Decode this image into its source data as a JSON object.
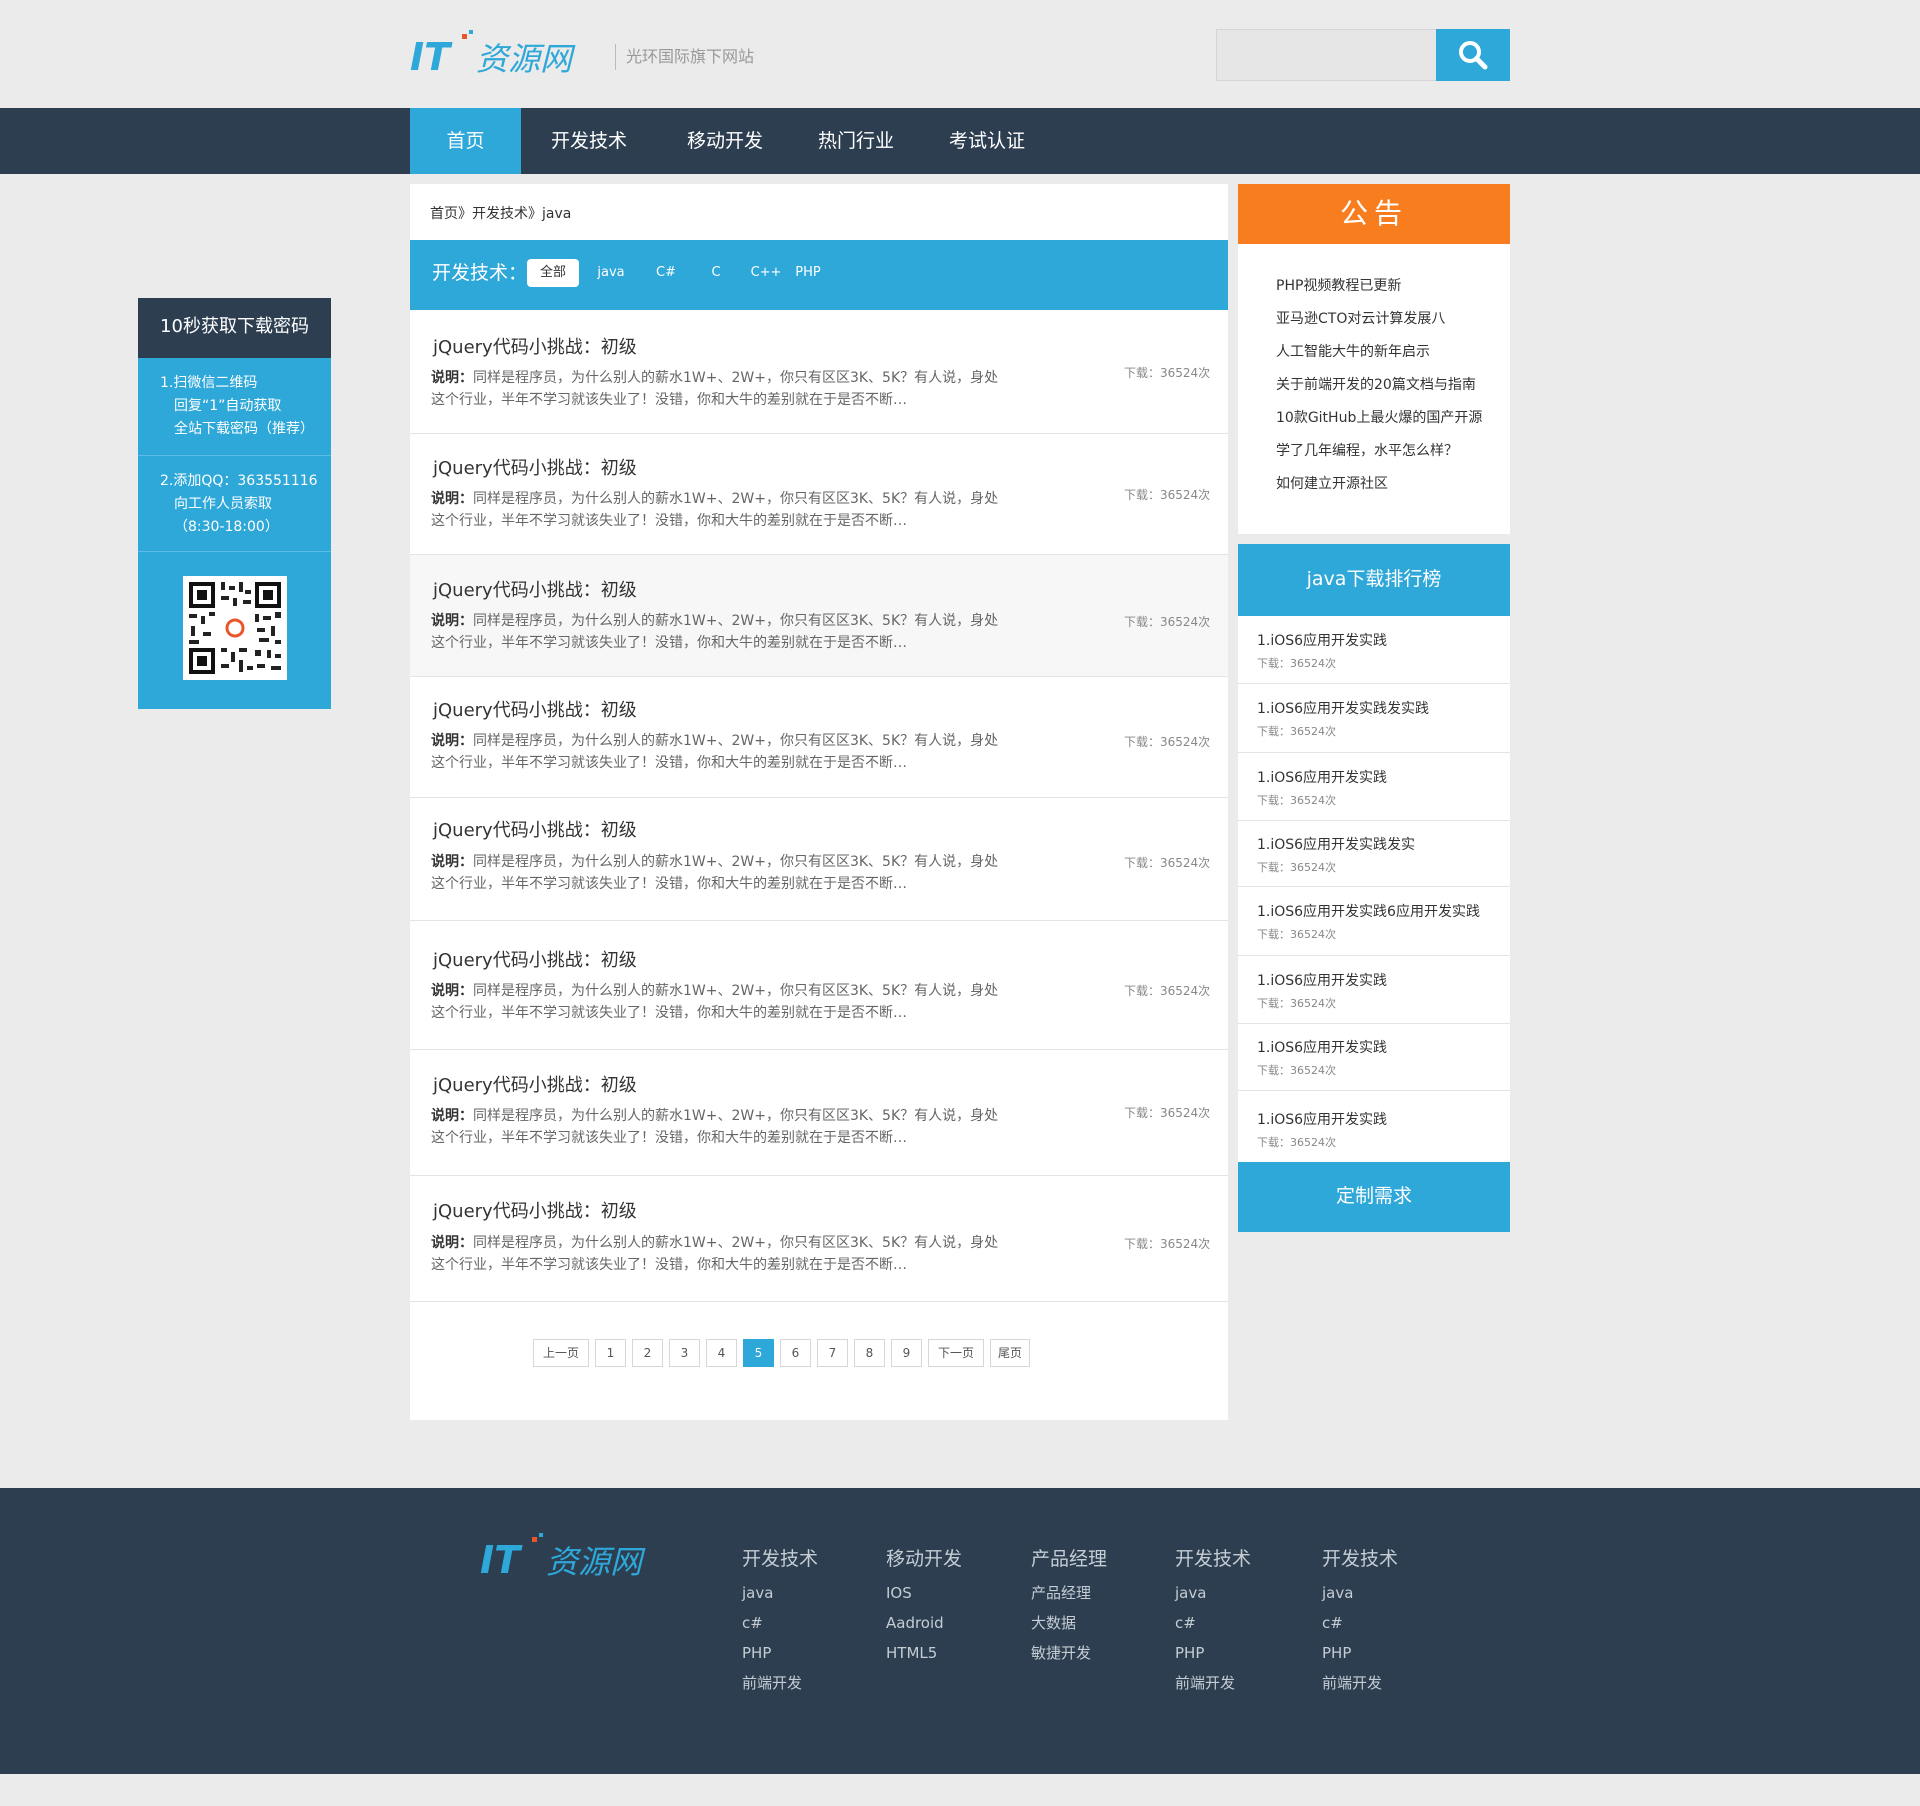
{
  "header": {
    "logo_text": "IT资源网",
    "slogan": "光环国际旗下网站",
    "search_placeholder": ""
  },
  "nav": {
    "items": [
      "首页",
      "开发技术",
      "移动开发",
      "热门行业",
      "考试认证"
    ],
    "active": 0
  },
  "float_panel": {
    "title": "10秒获取下载密码",
    "step1": [
      "1.扫微信二维码",
      "回复“1”自动获取",
      "全站下载密码（推荐）"
    ],
    "step2": [
      "2.添加QQ：363551116",
      "向工作人员索取",
      "（8:30-18:00）"
    ]
  },
  "breadcrumb": "首页》开发技术》java",
  "category": {
    "label": "开发技术：",
    "tabs": [
      "全部",
      "java",
      "C#",
      "C",
      "C++",
      "PHP"
    ],
    "selected": 0
  },
  "items": [
    {
      "title": "jQuery代码小挑战：初级",
      "desc_label": "说明：",
      "desc": "同样是程序员，为什么别人的薪水1W+、2W+，你只有区区3K、5K？有人说，身处这个行业，半年不学习就该失业了！没错，你和大牛的差别就在于是否不断…",
      "downloads": "下载：36524次"
    },
    {
      "title": "jQuery代码小挑战：初级",
      "desc_label": "说明：",
      "desc": "同样是程序员，为什么别人的薪水1W+、2W+，你只有区区3K、5K？有人说，身处这个行业，半年不学习就该失业了！没错，你和大牛的差别就在于是否不断…",
      "downloads": "下载：36524次"
    },
    {
      "title": "jQuery代码小挑战：初级",
      "desc_label": "说明：",
      "desc": "同样是程序员，为什么别人的薪水1W+、2W+，你只有区区3K、5K？有人说，身处这个行业，半年不学习就该失业了！没错，你和大牛的差别就在于是否不断…",
      "downloads": "下载：36524次"
    },
    {
      "title": "jQuery代码小挑战：初级",
      "desc_label": "说明：",
      "desc": "同样是程序员，为什么别人的薪水1W+、2W+，你只有区区3K、5K？有人说，身处这个行业，半年不学习就该失业了！没错，你和大牛的差别就在于是否不断…",
      "downloads": "下载：36524次"
    },
    {
      "title": "jQuery代码小挑战：初级",
      "desc_label": "说明：",
      "desc": "同样是程序员，为什么别人的薪水1W+、2W+，你只有区区3K、5K？有人说，身处这个行业，半年不学习就该失业了！没错，你和大牛的差别就在于是否不断…",
      "downloads": "下载：36524次"
    },
    {
      "title": "jQuery代码小挑战：初级",
      "desc_label": "说明：",
      "desc": "同样是程序员，为什么别人的薪水1W+、2W+，你只有区区3K、5K？有人说，身处这个行业，半年不学习就该失业了！没错，你和大牛的差别就在于是否不断…",
      "downloads": "下载：36524次"
    },
    {
      "title": "jQuery代码小挑战：初级",
      "desc_label": "说明：",
      "desc": "同样是程序员，为什么别人的薪水1W+、2W+，你只有区区3K、5K？有人说，身处这个行业，半年不学习就该失业了！没错，你和大牛的差别就在于是否不断…",
      "downloads": "下载：36524次"
    },
    {
      "title": "jQuery代码小挑战：初级",
      "desc_label": "说明：",
      "desc": "同样是程序员，为什么别人的薪水1W+、2W+，你只有区区3K、5K？有人说，身处这个行业，半年不学习就该失业了！没错，你和大牛的差别就在于是否不断…",
      "downloads": "下载：36524次"
    }
  ],
  "pagination": {
    "prev": "上一页",
    "pages": [
      "1",
      "2",
      "3",
      "4",
      "5",
      "6",
      "7",
      "8",
      "9"
    ],
    "current": "5",
    "next": "下一页",
    "last": "尾页"
  },
  "notice": {
    "title": "公告",
    "items": [
      "PHP视频教程已更新",
      "亚马逊CTO对云计算发展八",
      "人工智能大牛的新年启示",
      "关于前端开发的20篇文档与指南",
      "10款GitHub上最火爆的国产开源",
      "学了几年编程，水平怎么样？",
      "如何建立开源社区"
    ]
  },
  "ranking": {
    "title": "java下载排行榜",
    "items": [
      {
        "title": "1.iOS6应用开发实践",
        "downloads": "下载：36524次"
      },
      {
        "title": "1.iOS6应用开发实践发实践",
        "downloads": "下载：36524次"
      },
      {
        "title": "1.iOS6应用开发实践",
        "downloads": "下载：36524次"
      },
      {
        "title": "1.iOS6应用开发实践发实",
        "downloads": "下载：36524次"
      },
      {
        "title": "1.iOS6应用开发实践6应用开发实践",
        "downloads": "下载：36524次"
      },
      {
        "title": "1.iOS6应用开发实践",
        "downloads": "下载：36524次"
      },
      {
        "title": "1.iOS6应用开发实践",
        "downloads": "下载：36524次"
      },
      {
        "title": "1.iOS6应用开发实践",
        "downloads": "下载：36524次"
      }
    ]
  },
  "custom_button": "定制需求",
  "footer": {
    "columns": [
      {
        "title": "开发技术",
        "links": [
          "java",
          "c#",
          "PHP",
          "前端开发"
        ]
      },
      {
        "title": "移动开发",
        "links": [
          "IOS",
          "Aadroid",
          "HTML5"
        ]
      },
      {
        "title": "产品经理",
        "links": [
          "产品经理",
          "大数据",
          "敏捷开发"
        ]
      },
      {
        "title": "开发技术",
        "links": [
          "java",
          "c#",
          "PHP",
          "前端开发"
        ]
      },
      {
        "title": "开发技术",
        "links": [
          "java",
          "c#",
          "PHP",
          "前端开发"
        ]
      }
    ]
  },
  "colors": {
    "accent_blue": "#2ea7d9",
    "dark_navy": "#2c3e50",
    "notice_orange": "#f77d1e"
  }
}
